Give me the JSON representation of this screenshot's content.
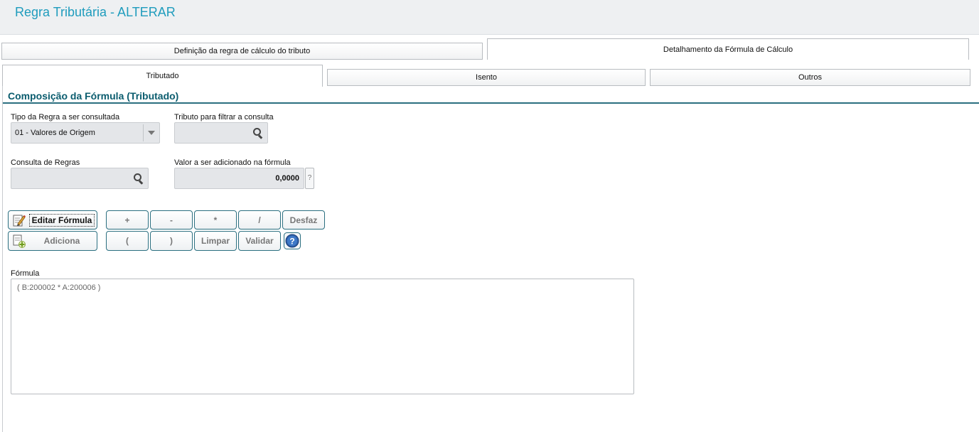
{
  "page": {
    "title": "Regra Tributária - ALTERAR"
  },
  "tabs_top": [
    {
      "label": "Definição da regra de cálculo do tributo",
      "active": false
    },
    {
      "label": "Detalhamento da Fórmula de Cálculo",
      "active": true
    }
  ],
  "tabs_sub": [
    {
      "label": "Tributado",
      "active": true
    },
    {
      "label": "Isento",
      "active": false
    },
    {
      "label": "Outros",
      "active": false
    }
  ],
  "section": {
    "title": "Composição da Fórmula (Tributado)"
  },
  "fields": {
    "tipo_regra": {
      "label": "Tipo da Regra a ser consultada",
      "value": "01 - Valores de Origem"
    },
    "tributo": {
      "label": "Tributo para filtrar a consulta",
      "value": ""
    },
    "consulta": {
      "label": "Consulta de Regras",
      "value": ""
    },
    "valor": {
      "label": "Valor a ser adicionado na fórmula",
      "value": "0,0000",
      "help": "?"
    }
  },
  "buttons": {
    "editar_formula": "Editar Fórmula",
    "adiciona": "Adiciona",
    "plus": "+",
    "minus": "-",
    "times": "*",
    "divide": "/",
    "desfaz": "Desfaz",
    "open_paren": "(",
    "close_paren": ")",
    "limpar": "Limpar",
    "validar": "Validar"
  },
  "formula": {
    "label": "Fórmula",
    "value": "( B:200002 * A:200006 )"
  },
  "colors": {
    "accent": "#1f9cbd",
    "section": "#0a5c6e",
    "border": "#2b6f80"
  },
  "icons": [
    "search-icon",
    "edit-pencil-icon",
    "add-document-icon",
    "help-icon",
    "dropdown-caret-icon"
  ]
}
